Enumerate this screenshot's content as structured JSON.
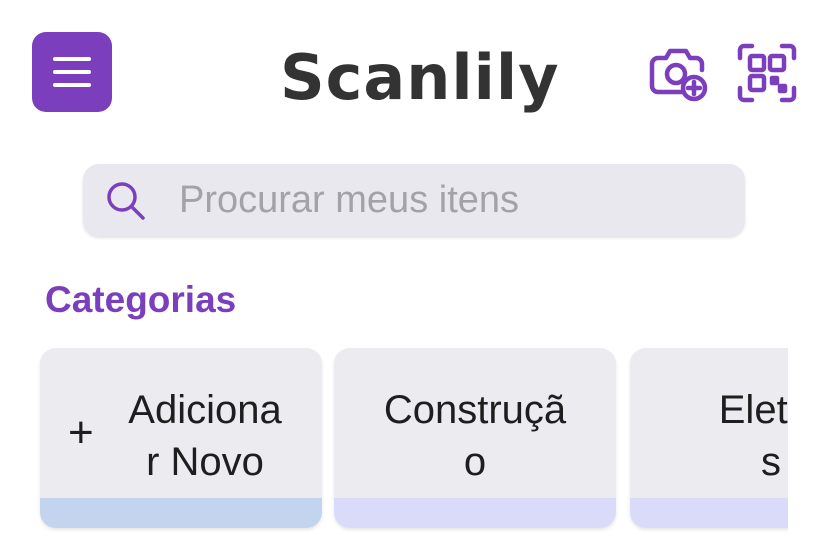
{
  "header": {
    "title": "Scanlily",
    "menu_icon": "hamburger-menu-icon",
    "camera_icon": "camera-add-icon",
    "qr_icon": "qr-scan-icon",
    "accent_color": "#7b3fbe"
  },
  "search": {
    "placeholder": "Procurar meus itens",
    "value": ""
  },
  "categories": {
    "title": "Categorias",
    "items": [
      {
        "label": "Adiciona r Novo",
        "line1": "Adiciona",
        "line2": "r Novo",
        "icon": "plus-icon",
        "stripe_color": "#c3d4ee"
      },
      {
        "label": "Construção",
        "line1": "Construçã",
        "line2": "o",
        "stripe_color": "#d9dbf9"
      },
      {
        "label": "Eletrô s",
        "line1": "Eletrô",
        "line2": "s",
        "stripe_color": "#d9dbf9"
      }
    ]
  }
}
